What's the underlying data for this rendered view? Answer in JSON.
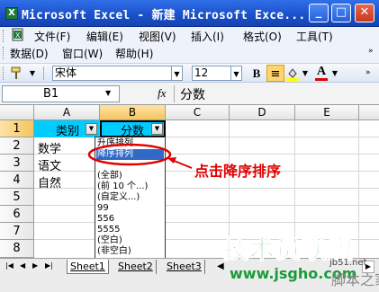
{
  "window": {
    "title": "Microsoft Excel - 新建 Microsoft Exce...",
    "app_icon": "excel-icon",
    "controls": {
      "minimize": "_",
      "maximize": "□",
      "close": "✕"
    }
  },
  "menubar": {
    "row1": [
      "文件(F)",
      "编辑(E)",
      "视图(V)",
      "插入(I)",
      "格式(O)",
      "工具(T)"
    ],
    "row2": [
      "数据(D)",
      "窗口(W)",
      "帮助(H)"
    ]
  },
  "toolbar": {
    "font_name": "宋体",
    "font_size": "12",
    "bold": "B",
    "align": "≡",
    "font_color_letter": "A",
    "font_color": "#e00000"
  },
  "formula_bar": {
    "name_box": "B1",
    "fx": "fx",
    "content": "分数"
  },
  "grid": {
    "columns": [
      "A",
      "B",
      "C",
      "D",
      "E"
    ],
    "rows": [
      "1",
      "2",
      "3",
      "4",
      "5",
      "6",
      "7",
      "8"
    ],
    "header_fill": "#00ccff",
    "cells": {
      "A1": "类别",
      "B1": "分数",
      "A2": "数学",
      "A3": "语文",
      "A4": "自然"
    }
  },
  "autofilter_dropdown": {
    "options": [
      "升序排列",
      "降序排列",
      "",
      "(全部)",
      "(前 10 个...)",
      "(自定义...)",
      "99",
      "556",
      "5555",
      "(空白)",
      "(非空白)"
    ],
    "highlighted_index": 1
  },
  "annotation": {
    "text": "点击降序排序",
    "color": "#e00000"
  },
  "sheet_tabs": {
    "nav": [
      "|◀",
      "◀",
      "▶",
      "▶|"
    ],
    "tabs": [
      "Sheet1",
      "Sheet2",
      "Sheet3"
    ]
  },
  "watermark": {
    "title": "技术员联盟",
    "url": "www.jsgho.com",
    "corner": "jb51.net",
    "corner2": "脚本之家"
  }
}
